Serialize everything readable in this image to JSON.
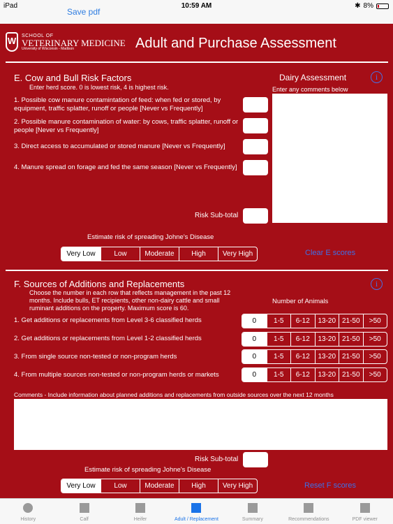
{
  "status": {
    "device": "iPad",
    "time": "10:59 AM",
    "battery": "8%"
  },
  "nav": {
    "save_pdf": "Save pdf"
  },
  "header": {
    "logo_line1": "SCHOOL OF",
    "logo_line2": "VETERINARY MEDICINE",
    "logo_line3": "University of Wisconsin - Madison",
    "crest_letter": "W",
    "title": "Adult and Purchase Assessment"
  },
  "sectionE": {
    "title": "E. Cow and Bull Risk Factors",
    "subtitle": "Enter herd score. 0 is lowest risk, 4 is highest risk.",
    "questions": [
      "1. Possible cow manure contamintation of feed: when fed or stored, by equipment, traffic splatter, runoff or people [Never vs Frequently]",
      "2. Possible manure contamination of water: by cows, traffic splatter, runoff or people [Never vs Frequently]",
      "3. Direct access to accumulated or stored manure [Never vs Frequently]",
      "4. Manure spread on forage and fed the same season [Never vs Frequently]"
    ],
    "subtotal_label": "Risk Sub-total",
    "dairy_title": "Dairy Assessment",
    "dairy_hint": "Enter any comments below",
    "estimate_label": "Estimate risk of spreading Johne's Disease",
    "risk_options": [
      "Very Low",
      "Low",
      "Moderate",
      "High",
      "Very High"
    ],
    "selected_risk": "Very Low",
    "clear_label": "Clear E scores"
  },
  "sectionF": {
    "title": "F. Sources of Additions and Replacements",
    "description": "Choose the number in each row that reflects management in the past 12 months. Include bulls, ET recipients, other non-dairy cattle and small ruminant additions on the property. Maximum score is 60.",
    "num_animals_label": "Number of Animals",
    "animal_options": [
      "0",
      "1-5",
      "6-12",
      "13-20",
      "21-50",
      ">50"
    ],
    "rows": [
      {
        "label": "1. Get additions or replacements from Level 3-6 classified herds",
        "selected": "0"
      },
      {
        "label": "2. Get additions or replacements from Level 1-2 classified herds",
        "selected": "0"
      },
      {
        "label": "3. From single source non-tested or non-program herds",
        "selected": "0"
      },
      {
        "label": "4. From multiple sources non-tested or non-program herds or markets",
        "selected": "0"
      }
    ],
    "comments_label": "Comments - Include information about planned additions and replacements from outside sources over the next 12 months",
    "subtotal_label": "Risk Sub-total",
    "estimate_label": "Estimate risk of spreading Johne's Disease",
    "risk_options": [
      "Very Low",
      "Low",
      "Moderate",
      "High",
      "Very High"
    ],
    "selected_risk": "Very Low",
    "reset_label": "Reset F scores"
  },
  "tabs": [
    {
      "label": "History",
      "icon": "circle-icon",
      "active": false
    },
    {
      "label": "Calf",
      "icon": "square-icon",
      "active": false
    },
    {
      "label": "Heifer",
      "icon": "square-icon",
      "active": false
    },
    {
      "label": "Adult / Replacement",
      "icon": "square-icon",
      "active": true
    },
    {
      "label": "Summary",
      "icon": "square-icon",
      "active": false
    },
    {
      "label": "Recommendations",
      "icon": "square-icon",
      "active": false
    },
    {
      "label": "PDF viewer",
      "icon": "square-icon",
      "active": false
    }
  ],
  "colors": {
    "background": "#a50e17",
    "link": "#3f6fe6",
    "active_tab": "#1a73e8"
  }
}
